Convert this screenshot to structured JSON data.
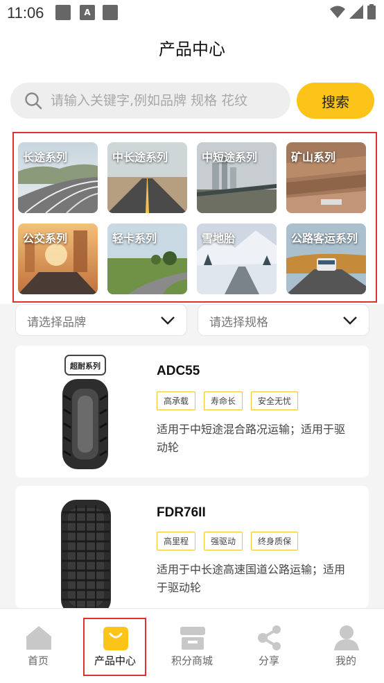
{
  "status": {
    "time": "11:06",
    "icons": [
      "notification-icon",
      "a-icon",
      "notification-icon"
    ],
    "right_icons": [
      "wifi-icon",
      "signal-icon",
      "battery-icon"
    ]
  },
  "header": {
    "title": "产品中心"
  },
  "search": {
    "placeholder": "请输入关键字,例如品牌 规格 花纹",
    "button": "搜索"
  },
  "categories": [
    {
      "label": "长途系列",
      "theme": "highway"
    },
    {
      "label": "中长途系列",
      "theme": "desert-road"
    },
    {
      "label": "中短途系列",
      "theme": "city-bridge"
    },
    {
      "label": "矿山系列",
      "theme": "mine"
    },
    {
      "label": "公交系列",
      "theme": "sunset-city"
    },
    {
      "label": "轻卡系列",
      "theme": "countryside"
    },
    {
      "label": "雪地胎",
      "theme": "snow"
    },
    {
      "label": "公路客运系列",
      "theme": "bus-road"
    }
  ],
  "filters": {
    "brand": "请选择品牌",
    "spec": "请选择规格"
  },
  "products": [
    {
      "name": "ADC55",
      "tags": [
        "高承载",
        "寿命长",
        "安全无忧"
      ],
      "desc": "适用于中短途混合路况运输；适用于驱动轮",
      "badge": "超耐系列"
    },
    {
      "name": "FDR76II",
      "tags": [
        "高里程",
        "强驱动",
        "终身质保"
      ],
      "desc": "适用于中长途高速国道公路运输；适用于驱动轮"
    }
  ],
  "tabs": [
    {
      "label": "首页",
      "icon": "home-icon"
    },
    {
      "label": "产品中心",
      "icon": "shopping-bag-icon",
      "active": true
    },
    {
      "label": "积分商城",
      "icon": "store-icon"
    },
    {
      "label": "分享",
      "icon": "share-icon"
    },
    {
      "label": "我的",
      "icon": "user-icon"
    }
  ],
  "colors": {
    "accent": "#fcc419",
    "highlight": "#e0302d",
    "tab_inactive": "#c8c8c8"
  }
}
